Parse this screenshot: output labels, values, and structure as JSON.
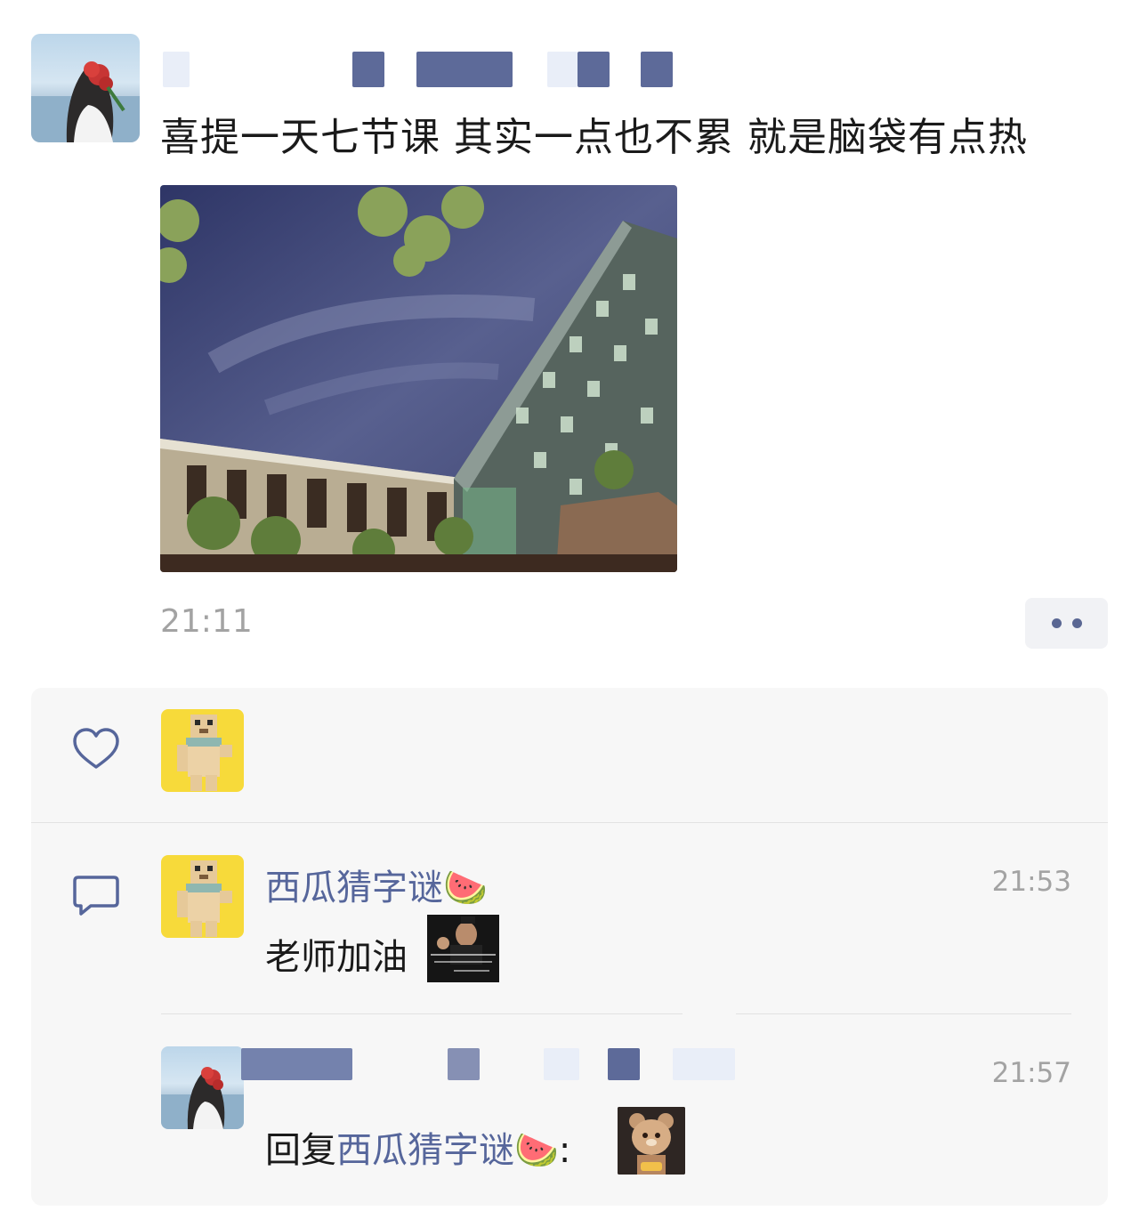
{
  "post": {
    "text": "喜提一天七节课 其实一点也不累 就是脑袋有点热",
    "time": "21:11"
  },
  "comments": [
    {
      "name": "西瓜猜字谜🍉",
      "time": "21:53",
      "text": "老师加油"
    },
    {
      "time": "21:57",
      "reply_prefix": "回复",
      "reply_to": "西瓜猜字谜🍉",
      "colon": ":"
    }
  ],
  "icons": {
    "like": "heart-outline-icon",
    "comment": "comment-bubble-icon",
    "more": "more-dots-icon"
  },
  "colors": {
    "link": "#56669b",
    "timestamp": "#a3a3a3",
    "panel": "#f7f7f7"
  }
}
